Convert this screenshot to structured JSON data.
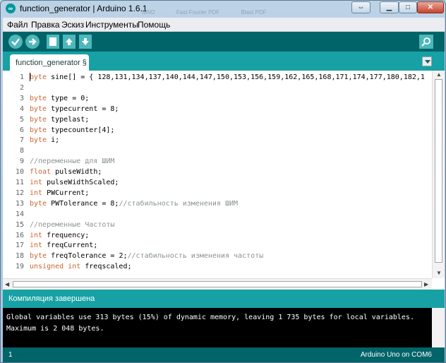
{
  "window": {
    "title": "function_generator | Arduino 1.6.1",
    "background_tabs": [
      "IBM2",
      "Fast Fourier PDF",
      "Blast PDF"
    ]
  },
  "menubar": {
    "items": [
      "Файл",
      "Правка",
      "Эскиз",
      "Инструменты",
      "Помощь"
    ]
  },
  "toolbar": {
    "buttons": [
      "verify-icon",
      "upload-icon",
      "new-icon",
      "open-icon",
      "save-icon"
    ],
    "serial_monitor": "magnifier-icon"
  },
  "tabs": [
    {
      "label": "function_generator §"
    }
  ],
  "editor": {
    "lines": [
      {
        "no": "1",
        "code": "byte sine[] = { 128,131,134,137,140,144,147,150,153,156,159,162,165,168,171,174,177,180,182,1"
      },
      {
        "no": "2",
        "code": ""
      },
      {
        "no": "3",
        "code": "byte type = 0;"
      },
      {
        "no": "4",
        "code": "byte typecurrent = 8;"
      },
      {
        "no": "5",
        "code": "byte typelast;"
      },
      {
        "no": "6",
        "code": "byte typecounter[4];"
      },
      {
        "no": "7",
        "code": "byte i;"
      },
      {
        "no": "8",
        "code": ""
      },
      {
        "no": "9",
        "code": "//переменные для ШИМ"
      },
      {
        "no": "10",
        "code": "float pulseWidth;"
      },
      {
        "no": "11",
        "code": "int pulseWidthScaled;"
      },
      {
        "no": "12",
        "code": "int PWCurrent;"
      },
      {
        "no": "13",
        "code": "byte PWTolerance = 8;//стабильность изменения ШИМ"
      },
      {
        "no": "14",
        "code": ""
      },
      {
        "no": "15",
        "code": "//переменные Частоты"
      },
      {
        "no": "16",
        "code": "int frequency;"
      },
      {
        "no": "17",
        "code": "int freqCurrent;"
      },
      {
        "no": "18",
        "code": "byte freqTolerance = 2;//стабильность изменения частоты"
      },
      {
        "no": "19",
        "code": "unsigned int freqscaled;"
      }
    ]
  },
  "status": {
    "message": "Компиляция завершена"
  },
  "console": {
    "lines": [
      "Global variables use 313 bytes (15%) of dynamic memory, leaving 1 735 bytes for local variables.",
      "Maximum is 2 048 bytes."
    ]
  },
  "footer": {
    "line": "1",
    "board": "Arduino Uno on COM6"
  },
  "colors": {
    "accent": "#17a1a5",
    "toolbar": "#006468",
    "keyword": "#cc6633",
    "comment": "#8a9293"
  }
}
